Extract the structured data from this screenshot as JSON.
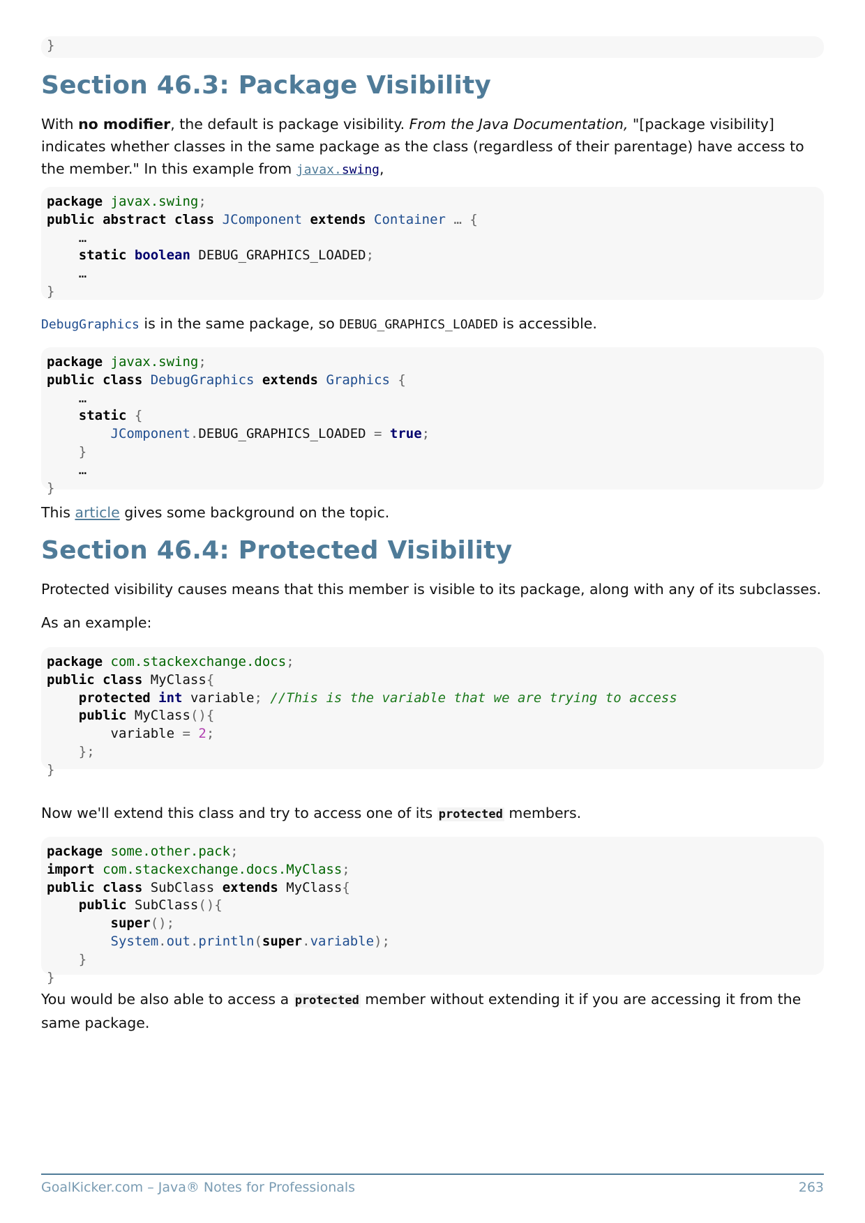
{
  "code_top": [
    "}"
  ],
  "section_463": {
    "heading": "Section 46.3: Package Visibility",
    "intro": {
      "pre": "With ",
      "bold": "no modifier",
      "mid": ", the default is package visibility. ",
      "italic": "From the Java Documentation,",
      "post": " \"[package visibility] indicates whether classes in the same package as the class (regardless of their parentage) have access to the member.\" In this example from ",
      "link_part1": "javax.",
      "link_part2": "swing",
      "end": ","
    },
    "code1": {
      "l1": {
        "kw": "package",
        "ns": "javax.swing",
        "pu": ";"
      },
      "l2": {
        "kw": "public abstract class",
        "ty": "JComponent",
        "kw2": "extends",
        "ty2": "Container",
        "pu": "… {"
      },
      "l3": "    …",
      "l4": {
        "indent": "    ",
        "kw": "static",
        "kt": "boolean",
        "name": "DEBUG_GRAPHICS_LOADED",
        "pu": ";"
      },
      "l5": "    …",
      "l6": "}"
    },
    "mid_text": {
      "code_a": "DebugGraphics",
      "text_a": " is in the same package, so ",
      "code_b": "DEBUG_GRAPHICS_LOADED",
      "text_b": " is accessible."
    },
    "code2": {
      "l1": {
        "kw": "package",
        "ns": "javax.swing",
        "pu": ";"
      },
      "l2": {
        "kw": "public class",
        "ty": "DebugGraphics",
        "kw2": "extends",
        "ty2": "Graphics",
        "pu": "{"
      },
      "l3": "    …",
      "l4": {
        "indent": "    ",
        "kw": "static",
        "pu": "{"
      },
      "l5": {
        "indent": "        ",
        "ty": "JComponent",
        "pu1": ".",
        "name": "DEBUG_GRAPHICS_LOADED",
        "pu2": " = ",
        "kt": "true",
        "pu3": ";"
      },
      "l6": "    }",
      "l7": "    …",
      "l8": "}"
    },
    "outro": {
      "pre": "This ",
      "link": "article",
      "post": " gives some background on the topic."
    }
  },
  "section_464": {
    "heading": "Section 46.4: Protected Visibility",
    "p1": "Protected visibility causes means that this member is visible to its package, along with any of its subclasses.",
    "p2": "As an example:",
    "code3": {
      "l1": {
        "kw": "package",
        "ns": "com.stackexchange.docs",
        "pu": ";"
      },
      "l2": {
        "kw": "public class",
        "name": "MyClass",
        "pu": "{"
      },
      "l3": {
        "indent": "    ",
        "kw": "protected",
        "kt": "int",
        "name": "variable",
        "pu": ";",
        "cm": "//This is the variable that we are trying to access"
      },
      "l4": {
        "indent": "    ",
        "kw": "public",
        "name": "MyClass",
        "pu": "(){"
      },
      "l5": {
        "indent": "        ",
        "name": "variable",
        "pu": " = ",
        "nm": "2",
        "pu2": ";"
      },
      "l6": "    };",
      "l7": "}"
    },
    "p3": {
      "pre": "Now we'll extend this class and try to access one of its ",
      "code": "protected",
      "post": " members."
    },
    "code4": {
      "l1": {
        "kw": "package",
        "ns": "some.other.pack",
        "pu": ";"
      },
      "l2": {
        "kw": "import",
        "ns": "com.stackexchange.docs.MyClass",
        "pu": ";"
      },
      "l3": {
        "kw": "public class",
        "name": "SubClass",
        "kw2": "extends",
        "name2": "MyClass",
        "pu": "{"
      },
      "l4": {
        "indent": "    ",
        "kw": "public",
        "name": "SubClass",
        "pu": "(){"
      },
      "l5": {
        "indent": "        ",
        "kw": "super",
        "pu": "();"
      },
      "l6": {
        "indent": "        ",
        "ty": "System",
        "pu1": ".",
        "ty2": "out",
        "pu2": ".",
        "ty3": "println",
        "pu3": "(",
        "kw": "super",
        "pu4": ".",
        "ty4": "variable",
        "pu5": ");"
      },
      "l7": "    }",
      "l8": "}"
    },
    "p4": {
      "pre": "You would be also able to access a ",
      "code": "protected",
      "post": " member without extending it if you are accessing it from the same package."
    }
  },
  "footer": {
    "left": "GoalKicker.com – Java® Notes for Professionals",
    "page": "263"
  }
}
